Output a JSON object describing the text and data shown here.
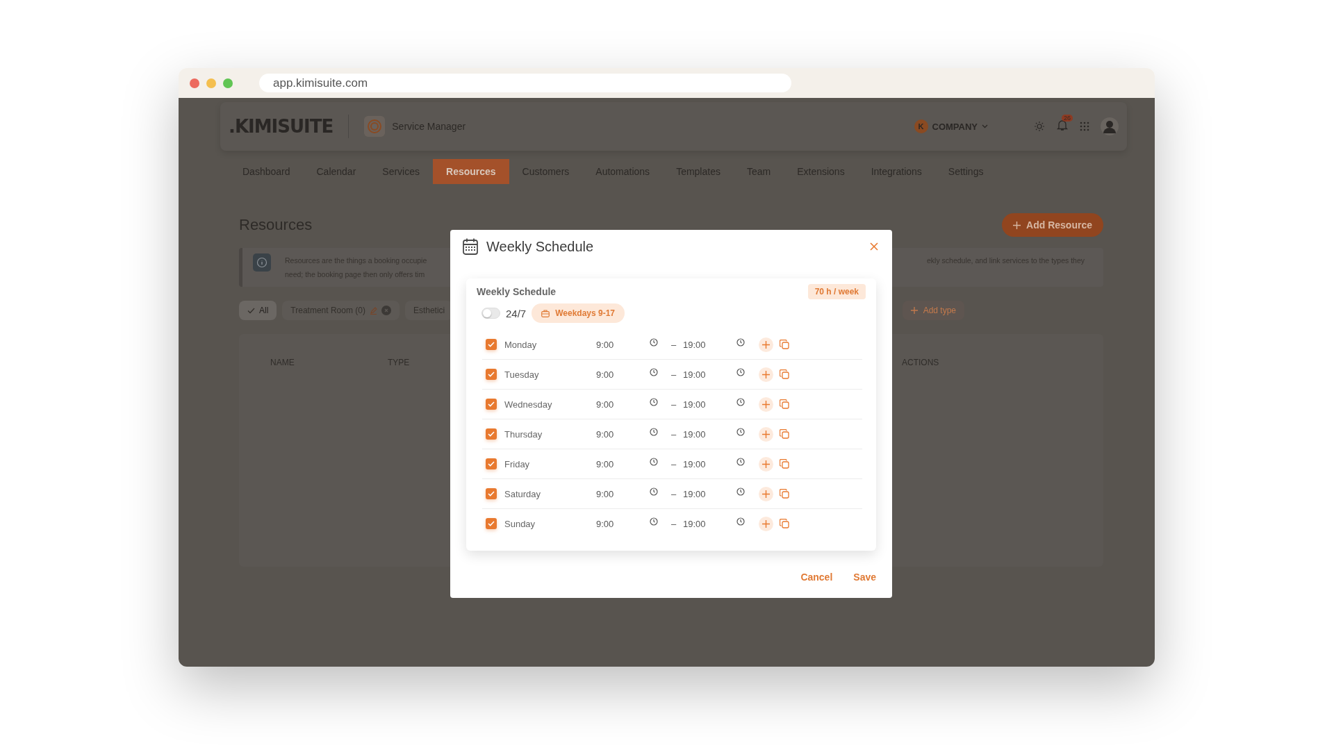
{
  "browser": {
    "url": "app.kimisuite.com"
  },
  "header": {
    "logo": ".KIMISUITE",
    "app_name": "Service Manager",
    "company": {
      "avatar": "K",
      "name": "COMPANY"
    },
    "notifications": "26"
  },
  "nav": [
    {
      "label": "Dashboard",
      "selected": false
    },
    {
      "label": "Calendar",
      "selected": false
    },
    {
      "label": "Services",
      "selected": false
    },
    {
      "label": "Resources",
      "selected": true
    },
    {
      "label": "Customers",
      "selected": false
    },
    {
      "label": "Automations",
      "selected": false
    },
    {
      "label": "Templates",
      "selected": false
    },
    {
      "label": "Team",
      "selected": false
    },
    {
      "label": "Extensions",
      "selected": false
    },
    {
      "label": "Integrations",
      "selected": false
    },
    {
      "label": "Settings",
      "selected": false
    }
  ],
  "page": {
    "title": "Resources",
    "add_button": "Add Resource",
    "info_left": [
      "Resources are the things a booking occupie",
      "need; the booking page then only offers tim"
    ],
    "info_right": "ekly schedule, and link services to the types they",
    "filters": [
      {
        "label": "All",
        "selected": true,
        "kind": "all"
      },
      {
        "label": "Treatment Room (0)",
        "selected": false,
        "kind": "type"
      },
      {
        "label": "Esthetici",
        "selected": false,
        "kind": "cut"
      }
    ],
    "add_type": "Add type",
    "columns": [
      "NAME",
      "TYPE",
      "ACTIONS"
    ]
  },
  "modal": {
    "title": "Weekly Schedule",
    "section_title": "Weekly Schedule",
    "total": "70 h / week",
    "always_open": {
      "label": "24/7",
      "on": false
    },
    "preset": "Weekdays 9-17",
    "days": [
      {
        "name": "Monday",
        "checked": true,
        "start": "9:00",
        "separator": "–",
        "end": "19:00"
      },
      {
        "name": "Tuesday",
        "checked": true,
        "start": "9:00",
        "separator": "–",
        "end": "19:00"
      },
      {
        "name": "Wednesday",
        "checked": true,
        "start": "9:00",
        "separator": "–",
        "end": "19:00"
      },
      {
        "name": "Thursday",
        "checked": true,
        "start": "9:00",
        "separator": "–",
        "end": "19:00"
      },
      {
        "name": "Friday",
        "checked": true,
        "start": "9:00",
        "separator": "–",
        "end": "19:00"
      },
      {
        "name": "Saturday",
        "checked": true,
        "start": "9:00",
        "separator": "–",
        "end": "19:00"
      },
      {
        "name": "Sunday",
        "checked": true,
        "start": "9:00",
        "separator": "–",
        "end": "19:00"
      }
    ],
    "buttons": [
      "Cancel",
      "Save"
    ]
  }
}
